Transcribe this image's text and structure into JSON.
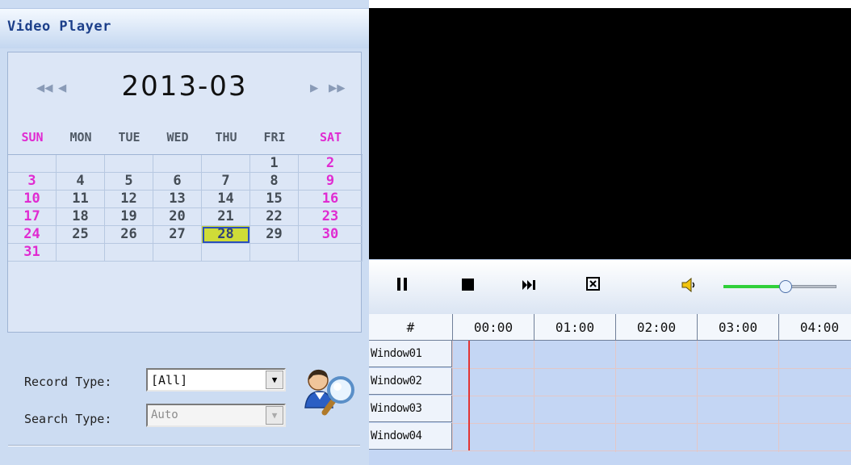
{
  "app": {
    "title": "Video Player"
  },
  "calendar": {
    "month_label": "2013-03",
    "nav": {
      "first": "◀◀",
      "prev": "◀",
      "next": "▶",
      "last": "▶▶"
    },
    "weekdays": [
      "SUN",
      "MON",
      "TUE",
      "WED",
      "THU",
      "FRI",
      "SAT"
    ],
    "weeks": [
      [
        "",
        "",
        "",
        "",
        "",
        "1",
        "2"
      ],
      [
        "3",
        "4",
        "5",
        "6",
        "7",
        "8",
        "9"
      ],
      [
        "10",
        "11",
        "12",
        "13",
        "14",
        "15",
        "16"
      ],
      [
        "17",
        "18",
        "19",
        "20",
        "21",
        "22",
        "23"
      ],
      [
        "24",
        "25",
        "26",
        "27",
        "28",
        "29",
        "30"
      ],
      [
        "31",
        "",
        "",
        "",
        "",
        "",
        ""
      ]
    ],
    "selected_day": "28",
    "weekend_color": "#e02bd1"
  },
  "search": {
    "record_type_label": "Record Type:",
    "record_type_value": "[All]",
    "search_type_label": "Search Type:",
    "search_type_value": "Auto",
    "search_icon": "user-search-icon"
  },
  "player": {
    "controls": {
      "pause_icon": "pause-icon",
      "stop_icon": "stop-icon",
      "step_icon": "next-frame-icon",
      "fullscreen_icon": "fullscreen-icon",
      "volume_icon": "speaker-icon"
    },
    "volume": 0.55,
    "volume_color": "#30d03a"
  },
  "timeline": {
    "corner": "#",
    "hours": [
      "00:00",
      "01:00",
      "02:00",
      "03:00",
      "04:00"
    ],
    "windows": [
      "Window01",
      "Window02",
      "Window03",
      "Window04"
    ],
    "cursor_color": "#e23434"
  }
}
